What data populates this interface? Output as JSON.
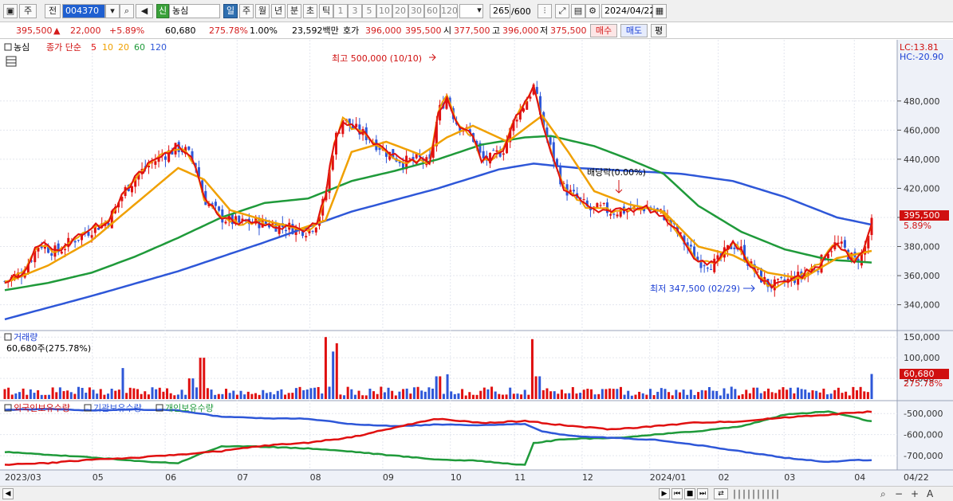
{
  "toolbar": {
    "type_label": "주",
    "prev_label": "전",
    "code_value": "004370",
    "market_badge": "신",
    "name_value": "농심",
    "period_tabs": [
      "일",
      "주",
      "월",
      "년",
      "분",
      "초",
      "틱"
    ],
    "active_period": "일",
    "interval_btns": [
      "1",
      "3",
      "5",
      "10",
      "20",
      "30",
      "60",
      "120"
    ],
    "count_value": "265",
    "count_total": "/600",
    "date_value": "2024/04/22"
  },
  "quote": {
    "price": "395,500",
    "change_arrow": "▲",
    "change": "22,000",
    "change_pct": "+5.89%",
    "volume": "60,680",
    "volume_ratio": "275.78%",
    "turnover_pct": "1.00%",
    "amount": "23,592백만",
    "bid_label": "호가",
    "bid1": "396,000",
    "bid2": "395,500",
    "open_label": "시",
    "open": "377,500",
    "high_label": "고",
    "high": "396,000",
    "low_label": "저",
    "low": "375,500",
    "buy_label": "매수",
    "sell_label": "매도",
    "avg_label": "평"
  },
  "legend": {
    "name": "농심",
    "price_label": "종가 단순",
    "ma_labels": [
      "5",
      "10",
      "20",
      "60",
      "120"
    ],
    "ma_colors": [
      "#e01010",
      "#f0a000",
      "#f0a000",
      "#1f9a3a",
      "#2e57d8"
    ],
    "lc": "LC:13.81",
    "hc": "HC:-20.90"
  },
  "annotations": {
    "high": "최고 500,000 (10/10)",
    "low": "최저 347,500 (02/29)",
    "dividend": "배당락(0.00%)"
  },
  "price_tag": {
    "value": "395,500",
    "pct": "5.89%"
  },
  "volume_panel": {
    "title": "거래량",
    "summary": "60,680주(275.78%)",
    "tag": "60,680",
    "tag_pct": "275.78%"
  },
  "holdings_panel": {
    "labels": [
      "외국인보유수량",
      "기관보유수량",
      "개인보유수량"
    ]
  },
  "colors": {
    "up": "#e01010",
    "down": "#2e57d8",
    "ma5": "#e01010",
    "ma10": "#f0a000",
    "ma20": "#f0a000",
    "ma60": "#1f9a3a",
    "ma120": "#2e57d8",
    "foreign": "#e01010",
    "inst": "#2e57d8",
    "indiv": "#1f9a3a",
    "axis_bg": "#eef1f8"
  },
  "chart_data": [
    {
      "type": "candlestick",
      "title": "농심",
      "ylim": [
        325000,
        510000
      ],
      "y_ticks": [
        340000,
        360000,
        380000,
        400000,
        420000,
        440000,
        460000,
        480000
      ],
      "y_tick_labels": [
        "340,000",
        "360,000",
        "380,000",
        "400,000",
        "420,000",
        "440,000",
        "460,000",
        "480,000"
      ],
      "x_labels": [
        "2023/03",
        "05",
        "06",
        "07",
        "08",
        "09",
        "10",
        "11",
        "12",
        "2024/01",
        "02",
        "03",
        "04",
        "04/22"
      ],
      "x_positions": [
        0,
        0.101,
        0.185,
        0.268,
        0.352,
        0.436,
        0.514,
        0.588,
        0.666,
        0.744,
        0.823,
        0.899,
        0.98,
        1.03
      ],
      "close_path": [
        [
          0,
          356000
        ],
        [
          0.02,
          362000
        ],
        [
          0.04,
          382000
        ],
        [
          0.06,
          376000
        ],
        [
          0.08,
          385000
        ],
        [
          0.1,
          392000
        ],
        [
          0.12,
          398000
        ],
        [
          0.14,
          420000
        ],
        [
          0.16,
          433000
        ],
        [
          0.18,
          442000
        ],
        [
          0.2,
          448000
        ],
        [
          0.21,
          445000
        ],
        [
          0.22,
          436000
        ],
        [
          0.23,
          413000
        ],
        [
          0.25,
          400000
        ],
        [
          0.27,
          396000
        ],
        [
          0.29,
          397000
        ],
        [
          0.31,
          395000
        ],
        [
          0.33,
          393000
        ],
        [
          0.35,
          391000
        ],
        [
          0.36,
          397000
        ],
        [
          0.37,
          415000
        ],
        [
          0.38,
          452000
        ],
        [
          0.39,
          468000
        ],
        [
          0.4,
          462000
        ],
        [
          0.42,
          455000
        ],
        [
          0.44,
          445000
        ],
        [
          0.46,
          438000
        ],
        [
          0.48,
          440000
        ],
        [
          0.49,
          436000
        ],
        [
          0.5,
          472000
        ],
        [
          0.51,
          484000
        ],
        [
          0.52,
          466000
        ],
        [
          0.54,
          455000
        ],
        [
          0.55,
          440000
        ],
        [
          0.56,
          440000
        ],
        [
          0.575,
          447000
        ],
        [
          0.59,
          470000
        ],
        [
          0.6,
          478000
        ],
        [
          0.61,
          490000
        ],
        [
          0.62,
          466000
        ],
        [
          0.63,
          446000
        ],
        [
          0.645,
          420000
        ],
        [
          0.66,
          413000
        ],
        [
          0.675,
          405000
        ],
        [
          0.69,
          406000
        ],
        [
          0.7,
          404000
        ],
        [
          0.72,
          405000
        ],
        [
          0.74,
          407000
        ],
        [
          0.76,
          402000
        ],
        [
          0.78,
          386000
        ],
        [
          0.8,
          370000
        ],
        [
          0.82,
          368000
        ],
        [
          0.83,
          375000
        ],
        [
          0.84,
          382000
        ],
        [
          0.85,
          377000
        ],
        [
          0.86,
          367000
        ],
        [
          0.87,
          360000
        ],
        [
          0.88,
          354000
        ],
        [
          0.89,
          353000
        ],
        [
          0.9,
          356000
        ],
        [
          0.915,
          359000
        ],
        [
          0.93,
          364000
        ],
        [
          0.94,
          368000
        ],
        [
          0.95,
          378000
        ],
        [
          0.96,
          382000
        ],
        [
          0.97,
          377000
        ],
        [
          0.98,
          370000
        ],
        [
          0.99,
          375000
        ],
        [
          1.0,
          395500
        ]
      ],
      "ma20_path": [
        [
          0,
          355000
        ],
        [
          0.05,
          367000
        ],
        [
          0.1,
          384000
        ],
        [
          0.15,
          409000
        ],
        [
          0.2,
          434000
        ],
        [
          0.23,
          426000
        ],
        [
          0.26,
          405000
        ],
        [
          0.3,
          398000
        ],
        [
          0.34,
          392000
        ],
        [
          0.37,
          398000
        ],
        [
          0.4,
          445000
        ],
        [
          0.44,
          452000
        ],
        [
          0.48,
          443000
        ],
        [
          0.51,
          455000
        ],
        [
          0.54,
          463000
        ],
        [
          0.58,
          452000
        ],
        [
          0.62,
          470000
        ],
        [
          0.65,
          445000
        ],
        [
          0.68,
          418000
        ],
        [
          0.72,
          409000
        ],
        [
          0.76,
          404000
        ],
        [
          0.8,
          380000
        ],
        [
          0.84,
          374000
        ],
        [
          0.88,
          362000
        ],
        [
          0.92,
          358000
        ],
        [
          0.96,
          372000
        ],
        [
          1.0,
          377000
        ]
      ],
      "ma60_path": [
        [
          0,
          350000
        ],
        [
          0.05,
          355000
        ],
        [
          0.1,
          362000
        ],
        [
          0.15,
          373000
        ],
        [
          0.2,
          386000
        ],
        [
          0.25,
          400000
        ],
        [
          0.3,
          410000
        ],
        [
          0.35,
          413000
        ],
        [
          0.4,
          425000
        ],
        [
          0.45,
          432000
        ],
        [
          0.5,
          440000
        ],
        [
          0.55,
          450000
        ],
        [
          0.6,
          455000
        ],
        [
          0.63,
          456000
        ],
        [
          0.68,
          449000
        ],
        [
          0.72,
          440000
        ],
        [
          0.76,
          430000
        ],
        [
          0.8,
          408000
        ],
        [
          0.85,
          390000
        ],
        [
          0.9,
          378000
        ],
        [
          0.95,
          371000
        ],
        [
          1.0,
          369000
        ]
      ],
      "ma120_path": [
        [
          0,
          330000
        ],
        [
          0.1,
          346000
        ],
        [
          0.2,
          363000
        ],
        [
          0.3,
          383000
        ],
        [
          0.4,
          404000
        ],
        [
          0.5,
          420000
        ],
        [
          0.57,
          433000
        ],
        [
          0.61,
          437000
        ],
        [
          0.66,
          434000
        ],
        [
          0.72,
          432000
        ],
        [
          0.78,
          430000
        ],
        [
          0.84,
          425000
        ],
        [
          0.9,
          414000
        ],
        [
          0.96,
          400000
        ],
        [
          1.0,
          395000
        ]
      ]
    },
    {
      "type": "bar",
      "title": "거래량",
      "ylim": [
        0,
        160000
      ],
      "y_ticks": [
        50000,
        100000,
        150000
      ],
      "y_tick_labels": [
        "50,000",
        "100,000",
        "150,000"
      ],
      "spikes": [
        [
          0.135,
          75000
        ],
        [
          0.215,
          50000
        ],
        [
          0.227,
          100000
        ],
        [
          0.37,
          150000
        ],
        [
          0.378,
          115000
        ],
        [
          0.382,
          135000
        ],
        [
          0.5,
          55000
        ],
        [
          0.51,
          60000
        ],
        [
          0.61,
          145000
        ],
        [
          0.615,
          55000
        ],
        [
          1.0,
          60680
        ]
      ]
    },
    {
      "type": "line",
      "title": "보유수량",
      "ylim": [
        -760000,
        -450000
      ],
      "y_ticks": [
        -500000,
        -600000,
        -700000
      ],
      "y_tick_labels": [
        "-500,000",
        "-600,000",
        "-700,000"
      ],
      "series": [
        {
          "name": "외국인보유수량",
          "path": [
            [
              0,
              -742000
            ],
            [
              0.05,
              -735000
            ],
            [
              0.1,
              -718000
            ],
            [
              0.15,
              -710000
            ],
            [
              0.2,
              -695000
            ],
            [
              0.25,
              -678000
            ],
            [
              0.3,
              -652000
            ],
            [
              0.35,
              -638000
            ],
            [
              0.4,
              -612000
            ],
            [
              0.43,
              -585000
            ],
            [
              0.47,
              -548000
            ],
            [
              0.5,
              -525000
            ],
            [
              0.55,
              -545000
            ],
            [
              0.6,
              -535000
            ],
            [
              0.65,
              -558000
            ],
            [
              0.7,
              -575000
            ],
            [
              0.75,
              -560000
            ],
            [
              0.8,
              -542000
            ],
            [
              0.85,
              -537000
            ],
            [
              0.9,
              -518000
            ],
            [
              0.95,
              -505000
            ],
            [
              1.0,
              -490000
            ]
          ]
        },
        {
          "name": "기관보유수량",
          "path": [
            [
              0,
              -482000
            ],
            [
              0.05,
              -478000
            ],
            [
              0.1,
              -485000
            ],
            [
              0.15,
              -480000
            ],
            [
              0.2,
              -485000
            ],
            [
              0.25,
              -515000
            ],
            [
              0.3,
              -522000
            ],
            [
              0.35,
              -525000
            ],
            [
              0.4,
              -550000
            ],
            [
              0.45,
              -560000
            ],
            [
              0.5,
              -552000
            ],
            [
              0.55,
              -555000
            ],
            [
              0.6,
              -550000
            ],
            [
              0.62,
              -585000
            ],
            [
              0.65,
              -605000
            ],
            [
              0.7,
              -615000
            ],
            [
              0.75,
              -625000
            ],
            [
              0.8,
              -650000
            ],
            [
              0.85,
              -680000
            ],
            [
              0.9,
              -710000
            ],
            [
              0.95,
              -730000
            ],
            [
              0.98,
              -720000
            ],
            [
              1.0,
              -722000
            ]
          ]
        },
        {
          "name": "개인보유수량",
          "path": [
            [
              0,
              -682000
            ],
            [
              0.05,
              -695000
            ],
            [
              0.1,
              -708000
            ],
            [
              0.15,
              -725000
            ],
            [
              0.2,
              -735000
            ],
            [
              0.22,
              -700000
            ],
            [
              0.25,
              -655000
            ],
            [
              0.3,
              -658000
            ],
            [
              0.35,
              -665000
            ],
            [
              0.4,
              -680000
            ],
            [
              0.45,
              -700000
            ],
            [
              0.5,
              -718000
            ],
            [
              0.55,
              -725000
            ],
            [
              0.6,
              -745000
            ],
            [
              0.61,
              -640000
            ],
            [
              0.65,
              -620000
            ],
            [
              0.7,
              -617000
            ],
            [
              0.75,
              -600000
            ],
            [
              0.8,
              -583000
            ],
            [
              0.85,
              -560000
            ],
            [
              0.9,
              -505000
            ],
            [
              0.95,
              -490000
            ],
            [
              1.0,
              -537000
            ]
          ]
        }
      ]
    }
  ]
}
